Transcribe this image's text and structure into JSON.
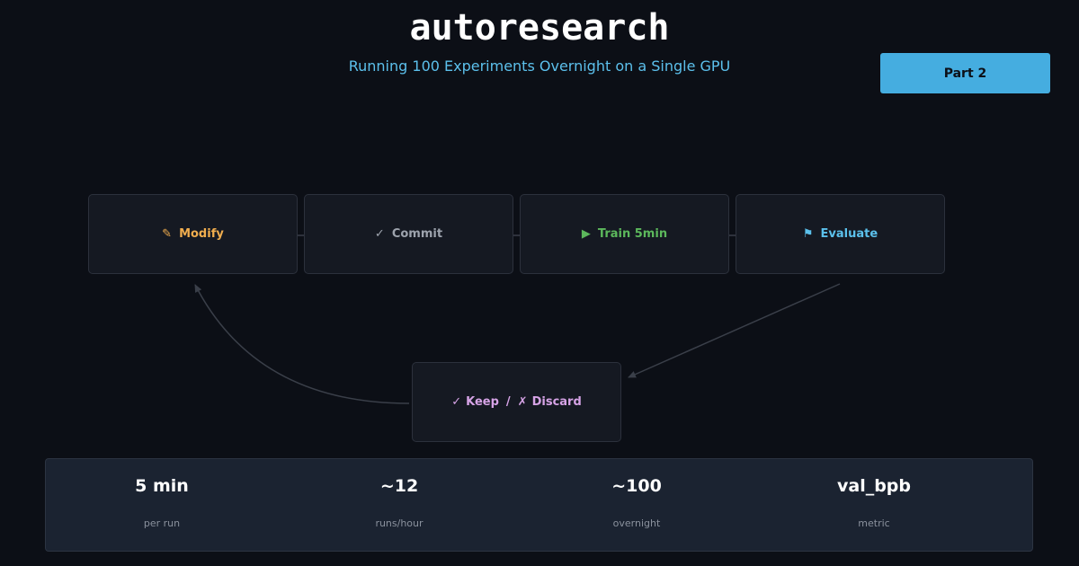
{
  "header": {
    "title": "autoresearch",
    "subtitle": "Running 100 Experiments Overnight on a Single GPU",
    "badge": "Part 2"
  },
  "diagram": {
    "nodes": [
      {
        "id": "modify",
        "icon": "✎",
        "icon_name": "pencil-icon",
        "label": "Modify",
        "color": "#f0ad4e"
      },
      {
        "id": "commit",
        "icon": "✓",
        "icon_name": "check-icon",
        "label": "Commit",
        "color": "#9da3ad"
      },
      {
        "id": "train",
        "icon": "▶",
        "icon_name": "play-icon",
        "label": "Train 5min",
        "color": "#5cb85c"
      },
      {
        "id": "evaluate",
        "icon": "⚑",
        "icon_name": "flag-icon",
        "label": "Evaluate",
        "color": "#5bc0eb"
      }
    ],
    "decision": {
      "keep_icon": "✓",
      "keep_label": "Keep",
      "separator": "/",
      "discard_icon": "✗",
      "discard_label": "Discard",
      "color": "#d6a3e6"
    },
    "edges": [
      {
        "from": "modify",
        "to": "commit"
      },
      {
        "from": "commit",
        "to": "train"
      },
      {
        "from": "train",
        "to": "evaluate"
      },
      {
        "from": "evaluate",
        "to": "decision"
      },
      {
        "from": "decision",
        "to": "modify"
      }
    ],
    "line_color": "#3a3f49"
  },
  "stats": [
    {
      "value": "5 min",
      "label": "per run"
    },
    {
      "value": "~12",
      "label": "runs/hour"
    },
    {
      "value": "~100",
      "label": "overnight"
    },
    {
      "value": "val_bpb",
      "label": "metric"
    }
  ]
}
